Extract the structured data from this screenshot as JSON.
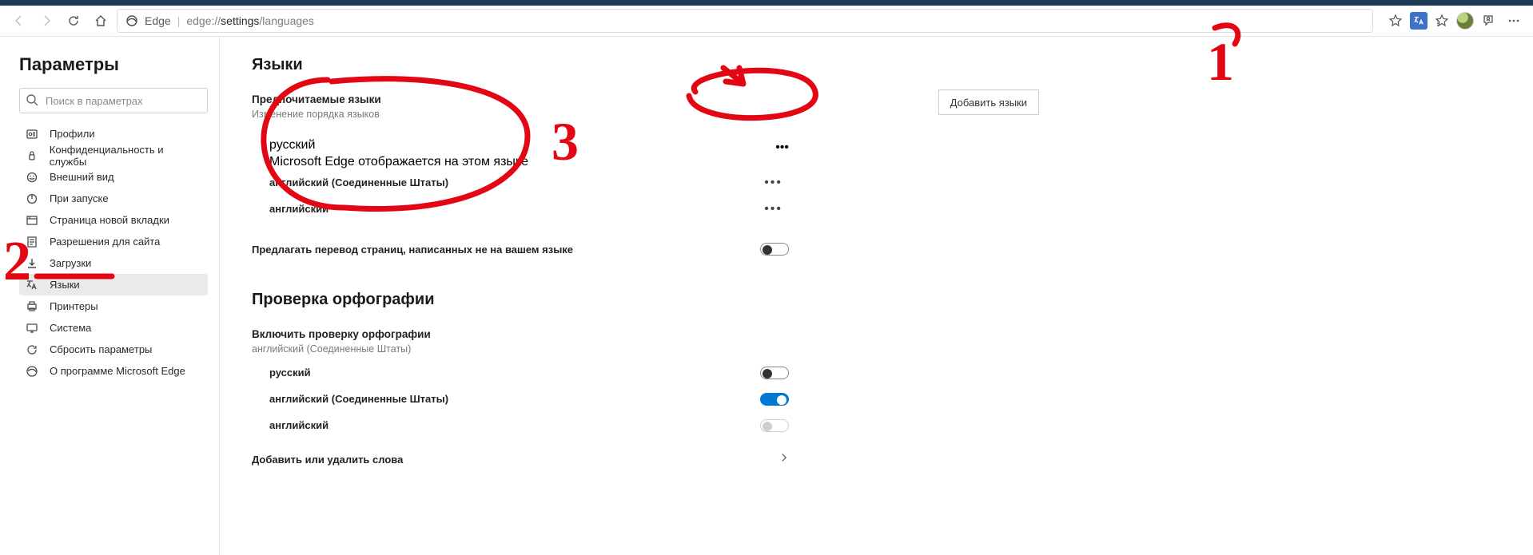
{
  "toolbar": {
    "site_name": "Edge",
    "url_prefix": "edge://",
    "url_mid": "settings",
    "url_suffix": "/languages"
  },
  "sidebar": {
    "title": "Параметры",
    "search_placeholder": "Поиск в параметрах",
    "items": [
      {
        "label": "Профили"
      },
      {
        "label": "Конфиденциальность и службы"
      },
      {
        "label": "Внешний вид"
      },
      {
        "label": "При запуске"
      },
      {
        "label": "Страница новой вкладки"
      },
      {
        "label": "Разрешения для сайта"
      },
      {
        "label": "Загрузки"
      },
      {
        "label": "Языки"
      },
      {
        "label": "Принтеры"
      },
      {
        "label": "Система"
      },
      {
        "label": "Сбросить параметры"
      },
      {
        "label": "О программе Microsoft Edge"
      }
    ],
    "active_index": 7
  },
  "main": {
    "languages_heading": "Языки",
    "preferred_heading": "Предпочитаемые языки",
    "preferred_caption": "Изменение порядка языков",
    "add_button": "Добавить языки",
    "langs": [
      {
        "name": "русский",
        "sub": "Microsoft Edge отображается на этом языке"
      },
      {
        "name": "английский (Соединенные Штаты)",
        "sub": ""
      },
      {
        "name": "английский",
        "sub": ""
      }
    ],
    "offer_translate_label": "Предлагать перевод страниц, написанных не на вашем языке",
    "offer_translate_on": false,
    "spell_heading": "Проверка орфографии",
    "spell_enable_label": "Включить проверку орфографии",
    "spell_enable_caption": "английский (Соединенные Штаты)",
    "spell_langs": [
      {
        "name": "русский",
        "state": "off"
      },
      {
        "name": "английский (Соединенные Штаты)",
        "state": "on"
      },
      {
        "name": "английский",
        "state": "disabled"
      }
    ],
    "add_remove_words": "Добавить или удалить слова"
  },
  "annotations": {
    "n1": "1",
    "n2": "2",
    "n3": "3"
  }
}
